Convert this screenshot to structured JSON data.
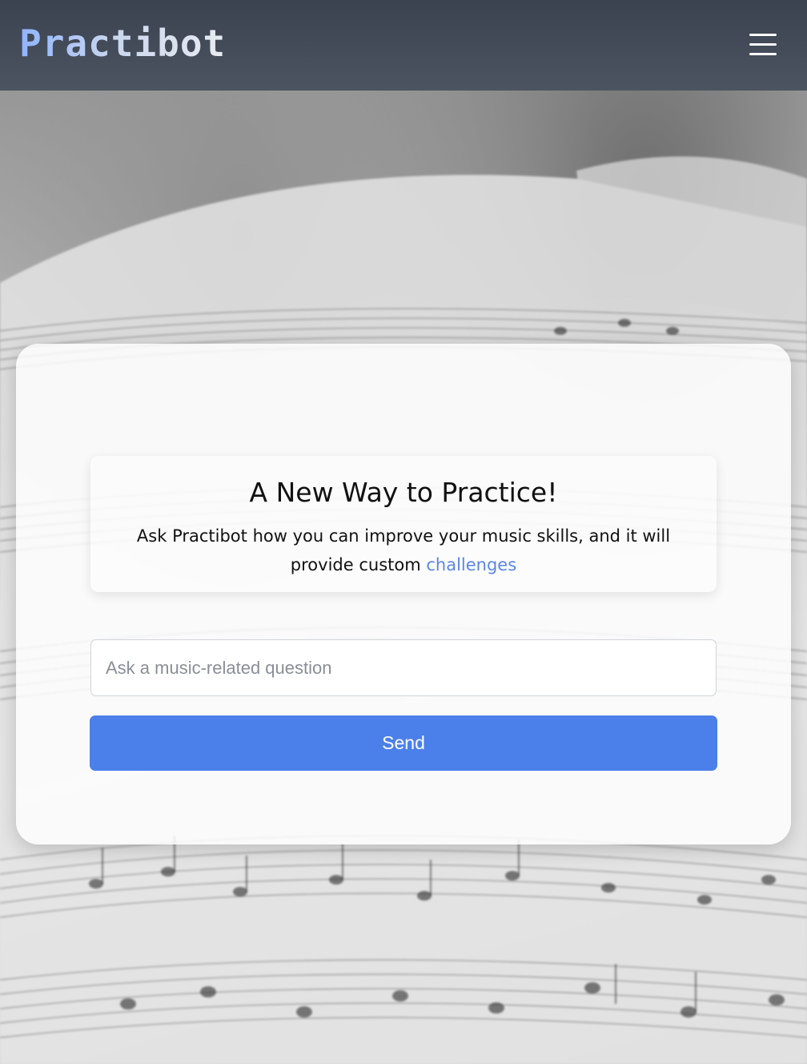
{
  "navbar": {
    "brand": "Practibot",
    "menu_icon": "hamburger-menu-icon"
  },
  "hero": {
    "title": "A New Way to Practice!",
    "description_before_link": "Ask Practibot how you can improve your music skills, and it will provide custom ",
    "link_text": "challenges"
  },
  "form": {
    "question_placeholder": "Ask a music-related question",
    "question_value": "",
    "send_label": "Send"
  },
  "colors": {
    "navbar": "#434a57",
    "accent": "#4b80ea",
    "link": "#5a86e6",
    "card": "#ffffff"
  },
  "background": {
    "image": "sheet-music-photo"
  }
}
